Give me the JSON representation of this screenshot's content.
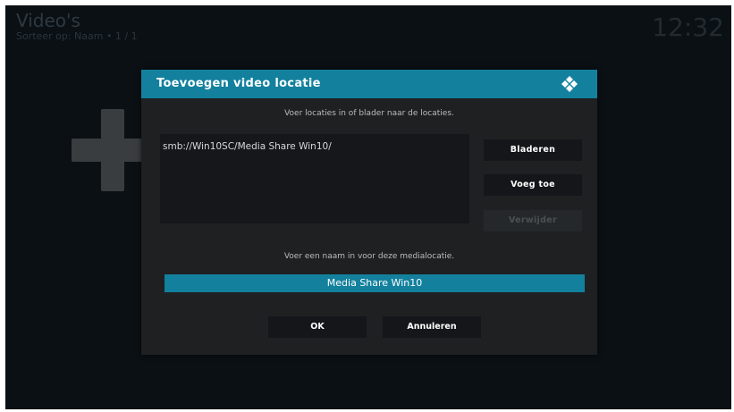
{
  "background": {
    "title": "Video's",
    "subtitle": "Sorteer op: Naam • 1 / 1",
    "clock": "12:32",
    "plus_icon": "plus-icon"
  },
  "dialog": {
    "title": "Toevoegen video locatie",
    "logo_icon": "kodi-logo-icon",
    "instruction_paths": "Voer locaties in of blader naar de locaties.",
    "paths": [
      "smb://Win10SC/Media Share Win10/"
    ],
    "buttons": {
      "browse": "Bladeren",
      "add": "Voeg toe",
      "remove": "Verwijder"
    },
    "instruction_name": "Voer een naam in voor deze medialocatie.",
    "name_value": "Media Share Win10",
    "ok": "OK",
    "cancel": "Annuleren"
  },
  "colors": {
    "accent": "#13819e",
    "dialog_bg": "#1e2022",
    "screen_bg": "#0b1014",
    "button_bg": "#141619"
  }
}
